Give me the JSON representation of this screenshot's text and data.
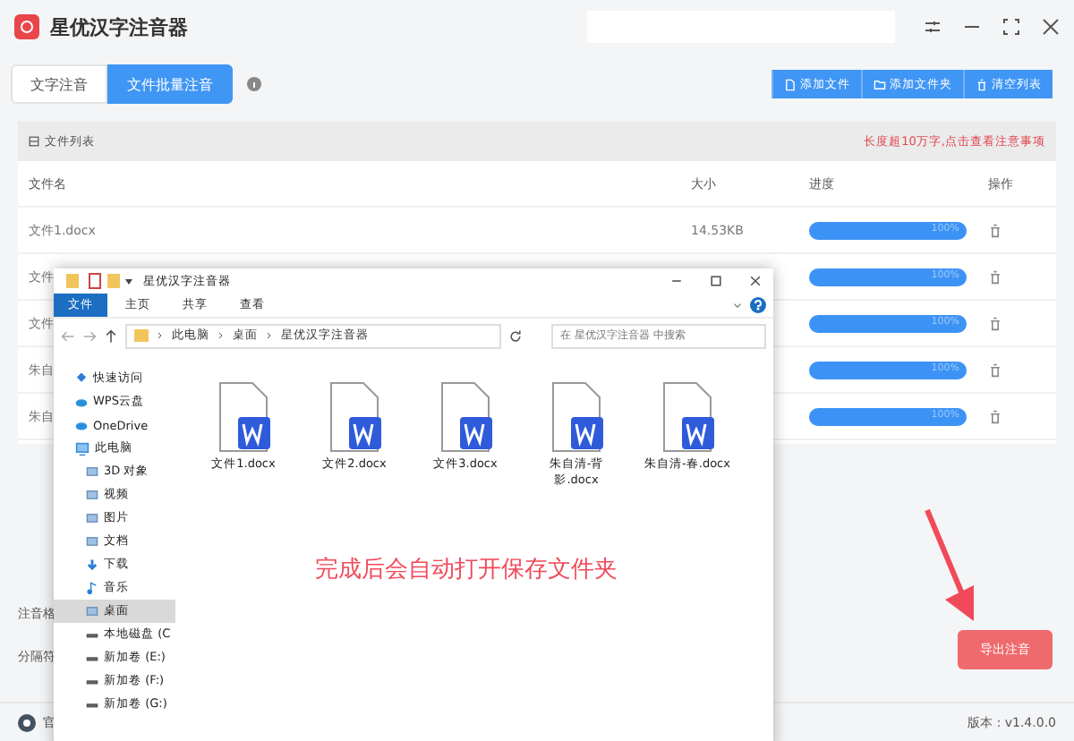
{
  "app": {
    "title": "星优汉字注音器"
  },
  "tabs": [
    {
      "label": "文字注音",
      "selected": false
    },
    {
      "label": "文件批量注音",
      "selected": true
    }
  ],
  "toolbar_buttons": [
    {
      "label": "添加文件",
      "kind": "file"
    },
    {
      "label": "添加文件夹",
      "kind": "folder"
    },
    {
      "label": "清空列表",
      "kind": "trash"
    }
  ],
  "file_list": {
    "title": "文件列表",
    "notice": "长度超10万字,点击查看注意事项",
    "columns": [
      "文件名",
      "大小",
      "进度",
      "操作"
    ],
    "rows": [
      {
        "name": "文件1.docx",
        "size": "14.53KB",
        "level": 1,
        "reading": "100%"
      },
      {
        "name": "文件",
        "size": "",
        "level": 1,
        "reading": "100%"
      },
      {
        "name": "文件",
        "size": "",
        "level": 1,
        "reading": "100%"
      },
      {
        "name": "朱自",
        "size": "",
        "level": 1,
        "reading": "100%"
      },
      {
        "name": "朱自",
        "size": "",
        "level": 1,
        "reading": "100%"
      }
    ]
  },
  "settings": [
    {
      "label": "注音格"
    },
    {
      "label": "分隔符"
    }
  ],
  "export_button": "导出注音",
  "status_bar": {
    "left": "官",
    "version": "版本：v1.4.0.0"
  },
  "explorer": {
    "title": "星优汉字注音器",
    "ribbon_tabs": [
      {
        "label": "文件",
        "selected": true
      },
      {
        "label": "主页",
        "selected": false
      },
      {
        "label": "共享",
        "selected": false
      },
      {
        "label": "查看",
        "selected": false
      }
    ],
    "path": [
      "此电脑",
      "桌面",
      "星优汉字注音器"
    ],
    "search": {
      "placeholder": "在 星优汉字注音器 中搜索"
    },
    "nav": [
      {
        "label": "快速访问",
        "kind": "star",
        "selected": false
      },
      {
        "label": "WPS云盘",
        "kind": "cloud",
        "selected": false
      },
      {
        "label": "OneDrive",
        "kind": "cloud",
        "selected": false
      },
      {
        "label": "此电脑",
        "kind": "pc",
        "selected": false
      },
      {
        "label": "3D 对象",
        "kind": "folder",
        "selected": false
      },
      {
        "label": "视频",
        "kind": "folder",
        "selected": false
      },
      {
        "label": "图片",
        "kind": "folder",
        "selected": false
      },
      {
        "label": "文档",
        "kind": "folder",
        "selected": false
      },
      {
        "label": "下载",
        "kind": "download",
        "selected": false
      },
      {
        "label": "音乐",
        "kind": "music",
        "selected": false
      },
      {
        "label": "桌面",
        "kind": "folder",
        "selected": true
      },
      {
        "label": "本地磁盘 (C",
        "kind": "drive",
        "selected": false
      },
      {
        "label": "新加卷 (E:)",
        "kind": "drive",
        "selected": false
      },
      {
        "label": "新加卷 (F:)",
        "kind": "drive",
        "selected": false
      },
      {
        "label": "新加卷 (G:)",
        "kind": "drive",
        "selected": false
      }
    ],
    "files": [
      {
        "name": "文件1.docx"
      },
      {
        "name": "文件2.docx"
      },
      {
        "name": "文件3.docx"
      },
      {
        "name": "朱自清-背影.docx"
      },
      {
        "name": "朱自清-春.docx"
      }
    ],
    "caption": "完成后会自动打开保存文件夹"
  }
}
